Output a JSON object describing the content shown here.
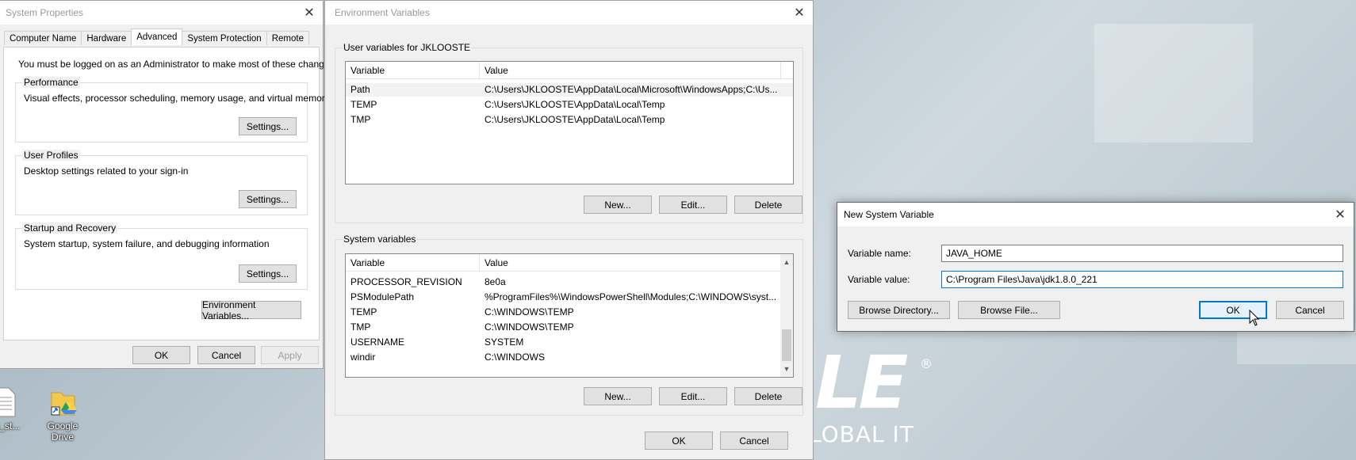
{
  "system_properties": {
    "title": "System Properties",
    "tabs": [
      "Computer Name",
      "Hardware",
      "Advanced",
      "System Protection",
      "Remote"
    ],
    "admin_note": "You must be logged on as an Administrator to make most of these changes.",
    "performance": {
      "label": "Performance",
      "description": "Visual effects, processor scheduling, memory usage, and virtual memory",
      "button": "Settings..."
    },
    "user_profiles": {
      "label": "User Profiles",
      "description": "Desktop settings related to your sign-in",
      "button": "Settings..."
    },
    "startup": {
      "label": "Startup and Recovery",
      "description": "System startup, system failure, and debugging information",
      "button": "Settings..."
    },
    "env_button": "Environment Variables...",
    "ok": "OK",
    "cancel": "Cancel",
    "apply": "Apply"
  },
  "env_vars": {
    "title": "Environment Variables",
    "user_group_label": "User variables for JKLOOSTE",
    "col_variable": "Variable",
    "col_value": "Value",
    "user_rows": [
      {
        "variable": "Path",
        "value": "C:\\Users\\JKLOOSTE\\AppData\\Local\\Microsoft\\WindowsApps;C:\\Us..."
      },
      {
        "variable": "TEMP",
        "value": "C:\\Users\\JKLOOSTE\\AppData\\Local\\Temp"
      },
      {
        "variable": "TMP",
        "value": "C:\\Users\\JKLOOSTE\\AppData\\Local\\Temp"
      }
    ],
    "system_group_label": "System variables",
    "system_rows": [
      {
        "variable": "PROCESSOR_REVISION",
        "value": "8e0a"
      },
      {
        "variable": "PSModulePath",
        "value": "%ProgramFiles%\\WindowsPowerShell\\Modules;C:\\WINDOWS\\syst..."
      },
      {
        "variable": "TEMP",
        "value": "C:\\WINDOWS\\TEMP"
      },
      {
        "variable": "TMP",
        "value": "C:\\WINDOWS\\TEMP"
      },
      {
        "variable": "USERNAME",
        "value": "SYSTEM"
      },
      {
        "variable": "windir",
        "value": "C:\\WINDOWS"
      }
    ],
    "new": "New...",
    "edit": "Edit...",
    "delete": "Delete",
    "ok": "OK",
    "cancel": "Cancel"
  },
  "new_var": {
    "title": "New System Variable",
    "name_label": "Variable name:",
    "name_value": "JAVA_HOME",
    "value_label": "Variable value:",
    "value_value": "C:\\Program Files\\Java\\jdk1.8.0_221",
    "browse_dir": "Browse Directory...",
    "browse_file": "Browse File...",
    "ok": "OK",
    "cancel": "Cancel"
  },
  "desktop": {
    "icon1_label": "ics_st...",
    "icon2_label": "Google Drive",
    "logo_letters": "LE",
    "logo_tagline": "LOBAL IT",
    "registered": "®"
  }
}
